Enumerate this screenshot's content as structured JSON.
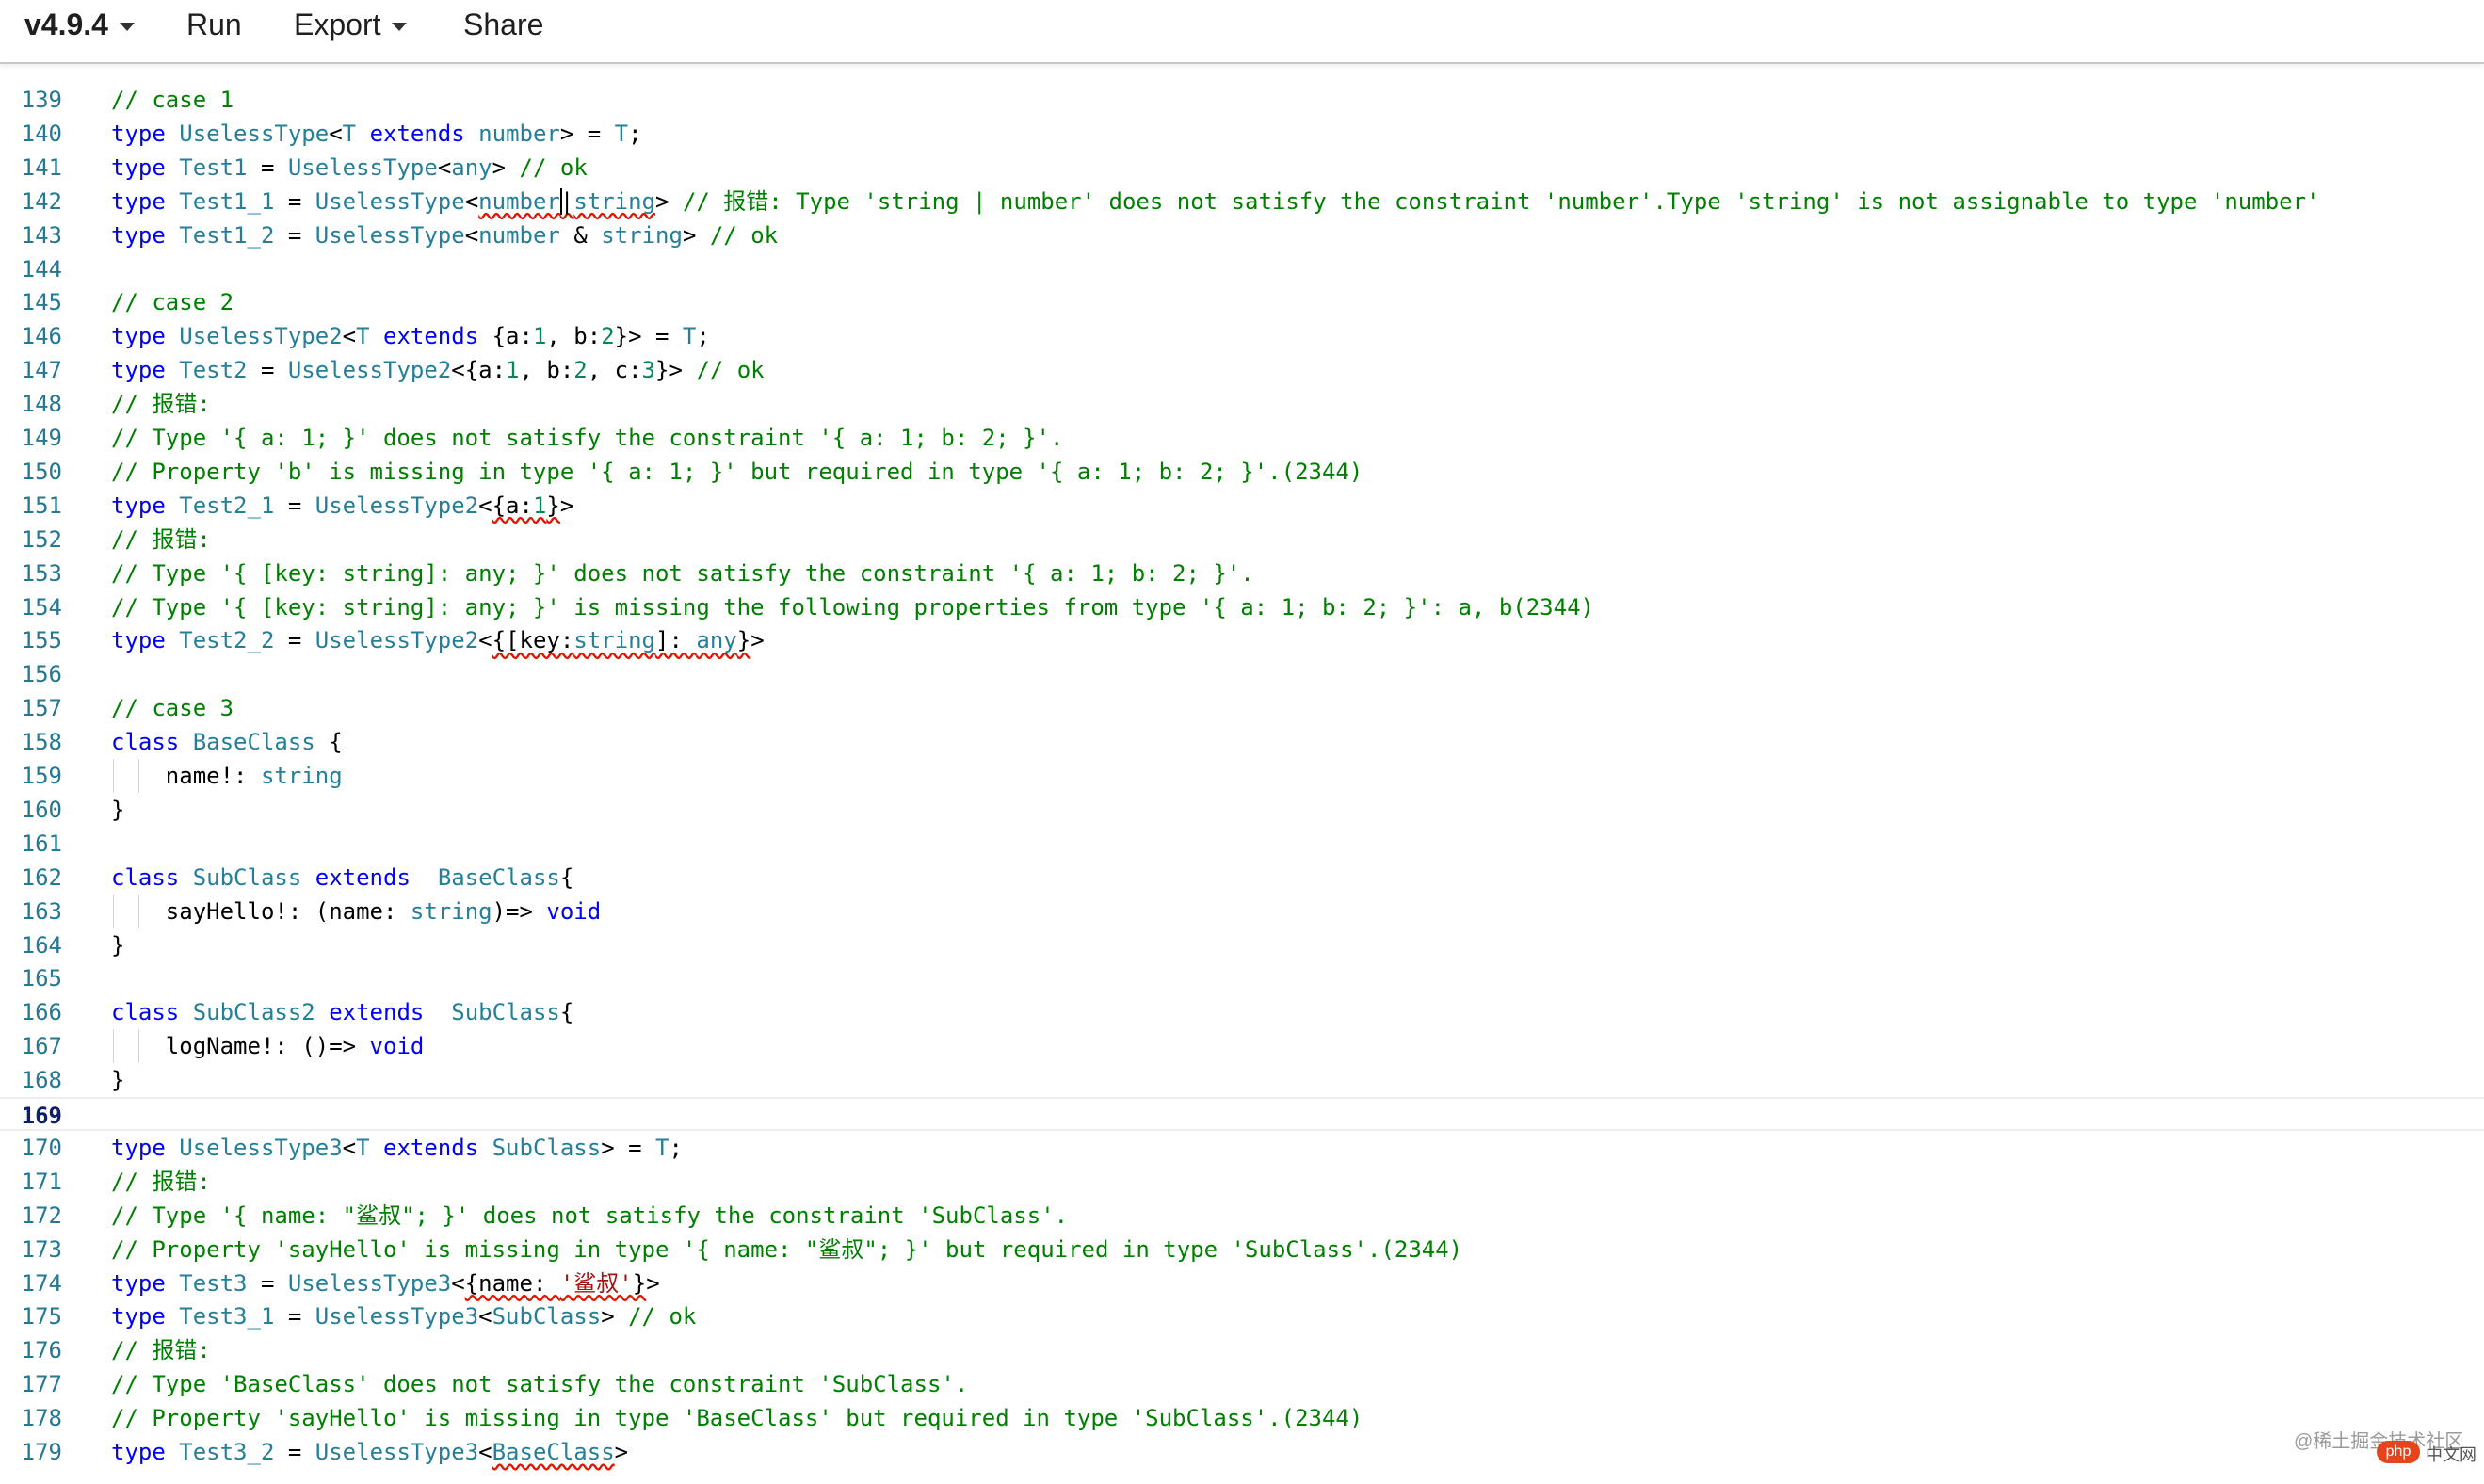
{
  "toolbar": {
    "version": "v4.9.4",
    "run": "Run",
    "export": "Export",
    "share": "Share"
  },
  "colors": {
    "keyword": "#0000ff",
    "type": "#267f99",
    "comment": "#008000",
    "string": "#a31515",
    "number": "#098658",
    "line_number": "#237893",
    "error_squiggle": "#e51400"
  },
  "editor": {
    "active_line": 169,
    "cursor": {
      "line": 142,
      "after_text": "type Test1_1 = UselessType<number"
    },
    "lines": [
      {
        "n": 139,
        "tokens": [
          [
            "comment",
            "// case 1"
          ]
        ]
      },
      {
        "n": 140,
        "tokens": [
          [
            "keyword",
            "type"
          ],
          [
            "plain",
            " "
          ],
          [
            "type",
            "UselessType"
          ],
          [
            "plain",
            "<"
          ],
          [
            "type",
            "T"
          ],
          [
            "plain",
            " "
          ],
          [
            "keyword",
            "extends"
          ],
          [
            "plain",
            " "
          ],
          [
            "type",
            "number"
          ],
          [
            "plain",
            "> = "
          ],
          [
            "type",
            "T"
          ],
          [
            "plain",
            ";"
          ]
        ]
      },
      {
        "n": 141,
        "tokens": [
          [
            "keyword",
            "type"
          ],
          [
            "plain",
            " "
          ],
          [
            "type",
            "Test1"
          ],
          [
            "plain",
            " = "
          ],
          [
            "type",
            "UselessType"
          ],
          [
            "plain",
            "<"
          ],
          [
            "type",
            "any"
          ],
          [
            "plain",
            "> "
          ],
          [
            "comment",
            "// ok"
          ]
        ]
      },
      {
        "n": 142,
        "tokens": [
          [
            "keyword",
            "type"
          ],
          [
            "plain",
            " "
          ],
          [
            "type",
            "Test1_1"
          ],
          [
            "plain",
            " = "
          ],
          [
            "type",
            "UselessType"
          ],
          [
            "plain",
            "<"
          ],
          [
            "type",
            "number",
            "err"
          ],
          [
            "plain",
            "|",
            "err"
          ],
          [
            "type",
            "string",
            "err"
          ],
          [
            "plain",
            "> "
          ],
          [
            "comment",
            "// 报错: Type 'string | number' does not satisfy the constraint 'number'.Type 'string' is not assignable to type 'number'"
          ]
        ]
      },
      {
        "n": 143,
        "tokens": [
          [
            "keyword",
            "type"
          ],
          [
            "plain",
            " "
          ],
          [
            "type",
            "Test1_2"
          ],
          [
            "plain",
            " = "
          ],
          [
            "type",
            "UselessType"
          ],
          [
            "plain",
            "<"
          ],
          [
            "type",
            "number"
          ],
          [
            "plain",
            " & "
          ],
          [
            "type",
            "string"
          ],
          [
            "plain",
            "> "
          ],
          [
            "comment",
            "// ok"
          ]
        ]
      },
      {
        "n": 144,
        "tokens": []
      },
      {
        "n": 145,
        "tokens": [
          [
            "comment",
            "// case 2"
          ]
        ]
      },
      {
        "n": 146,
        "tokens": [
          [
            "keyword",
            "type"
          ],
          [
            "plain",
            " "
          ],
          [
            "type",
            "UselessType2"
          ],
          [
            "plain",
            "<"
          ],
          [
            "type",
            "T"
          ],
          [
            "plain",
            " "
          ],
          [
            "keyword",
            "extends"
          ],
          [
            "plain",
            " {a:"
          ],
          [
            "number",
            "1"
          ],
          [
            "plain",
            ", b:"
          ],
          [
            "number",
            "2"
          ],
          [
            "plain",
            "}> = "
          ],
          [
            "type",
            "T"
          ],
          [
            "plain",
            ";"
          ]
        ]
      },
      {
        "n": 147,
        "tokens": [
          [
            "keyword",
            "type"
          ],
          [
            "plain",
            " "
          ],
          [
            "type",
            "Test2"
          ],
          [
            "plain",
            " = "
          ],
          [
            "type",
            "UselessType2"
          ],
          [
            "plain",
            "<{a:"
          ],
          [
            "number",
            "1"
          ],
          [
            "plain",
            ", b:"
          ],
          [
            "number",
            "2"
          ],
          [
            "plain",
            ", c:"
          ],
          [
            "number",
            "3"
          ],
          [
            "plain",
            "}> "
          ],
          [
            "comment",
            "// ok"
          ]
        ]
      },
      {
        "n": 148,
        "tokens": [
          [
            "comment",
            "// 报错:"
          ]
        ]
      },
      {
        "n": 149,
        "tokens": [
          [
            "comment",
            "// Type '{ a: 1; }' does not satisfy the constraint '{ a: 1; b: 2; }'."
          ]
        ]
      },
      {
        "n": 150,
        "tokens": [
          [
            "comment",
            "// Property 'b' is missing in type '{ a: 1; }' but required in type '{ a: 1; b: 2; }'.(2344)"
          ]
        ]
      },
      {
        "n": 151,
        "tokens": [
          [
            "keyword",
            "type"
          ],
          [
            "plain",
            " "
          ],
          [
            "type",
            "Test2_1"
          ],
          [
            "plain",
            " = "
          ],
          [
            "type",
            "UselessType2"
          ],
          [
            "plain",
            "<"
          ],
          [
            "plain",
            "{a:",
            "err"
          ],
          [
            "number",
            "1",
            "err"
          ],
          [
            "plain",
            "}",
            "err"
          ],
          [
            "plain",
            ">"
          ]
        ]
      },
      {
        "n": 152,
        "tokens": [
          [
            "comment",
            "// 报错:"
          ]
        ]
      },
      {
        "n": 153,
        "tokens": [
          [
            "comment",
            "// Type '{ [key: string]: any; }' does not satisfy the constraint '{ a: 1; b: 2; }'."
          ]
        ]
      },
      {
        "n": 154,
        "tokens": [
          [
            "comment",
            "// Type '{ [key: string]: any; }' is missing the following properties from type '{ a: 1; b: 2; }': a, b(2344)"
          ]
        ]
      },
      {
        "n": 155,
        "tokens": [
          [
            "keyword",
            "type"
          ],
          [
            "plain",
            " "
          ],
          [
            "type",
            "Test2_2"
          ],
          [
            "plain",
            " = "
          ],
          [
            "type",
            "UselessType2"
          ],
          [
            "plain",
            "<"
          ],
          [
            "plain",
            "{[key:",
            "err"
          ],
          [
            "type",
            "string",
            "err"
          ],
          [
            "plain",
            "]: ",
            "err"
          ],
          [
            "type",
            "any",
            "err"
          ],
          [
            "plain",
            "}",
            "err"
          ],
          [
            "plain",
            ">"
          ]
        ]
      },
      {
        "n": 156,
        "tokens": []
      },
      {
        "n": 157,
        "tokens": [
          [
            "comment",
            "// case 3"
          ]
        ]
      },
      {
        "n": 158,
        "tokens": [
          [
            "keyword",
            "class"
          ],
          [
            "plain",
            " "
          ],
          [
            "type",
            "BaseClass"
          ],
          [
            "plain",
            " {"
          ]
        ]
      },
      {
        "n": 159,
        "indent": 1,
        "tokens": [
          [
            "plain",
            "    name!: "
          ],
          [
            "type",
            "string"
          ]
        ]
      },
      {
        "n": 160,
        "tokens": [
          [
            "plain",
            "}"
          ]
        ]
      },
      {
        "n": 161,
        "tokens": []
      },
      {
        "n": 162,
        "tokens": [
          [
            "keyword",
            "class"
          ],
          [
            "plain",
            " "
          ],
          [
            "type",
            "SubClass"
          ],
          [
            "plain",
            " "
          ],
          [
            "keyword",
            "extends"
          ],
          [
            "plain",
            "  "
          ],
          [
            "type",
            "BaseClass"
          ],
          [
            "plain",
            "{"
          ]
        ]
      },
      {
        "n": 163,
        "indent": 1,
        "tokens": [
          [
            "plain",
            "    sayHello!: (name: "
          ],
          [
            "type",
            "string"
          ],
          [
            "plain",
            ")=> "
          ],
          [
            "keyword",
            "void"
          ]
        ]
      },
      {
        "n": 164,
        "tokens": [
          [
            "plain",
            "}"
          ]
        ]
      },
      {
        "n": 165,
        "tokens": []
      },
      {
        "n": 166,
        "tokens": [
          [
            "keyword",
            "class"
          ],
          [
            "plain",
            " "
          ],
          [
            "type",
            "SubClass2"
          ],
          [
            "plain",
            " "
          ],
          [
            "keyword",
            "extends"
          ],
          [
            "plain",
            "  "
          ],
          [
            "type",
            "SubClass"
          ],
          [
            "plain",
            "{"
          ]
        ]
      },
      {
        "n": 167,
        "indent": 1,
        "tokens": [
          [
            "plain",
            "    logName!: ()=> "
          ],
          [
            "keyword",
            "void"
          ]
        ]
      },
      {
        "n": 168,
        "tokens": [
          [
            "plain",
            "}"
          ]
        ]
      },
      {
        "n": 169,
        "tokens": []
      },
      {
        "n": 170,
        "tokens": [
          [
            "keyword",
            "type"
          ],
          [
            "plain",
            " "
          ],
          [
            "type",
            "UselessType3"
          ],
          [
            "plain",
            "<"
          ],
          [
            "type",
            "T"
          ],
          [
            "plain",
            " "
          ],
          [
            "keyword",
            "extends"
          ],
          [
            "plain",
            " "
          ],
          [
            "type",
            "SubClass"
          ],
          [
            "plain",
            "> = "
          ],
          [
            "type",
            "T"
          ],
          [
            "plain",
            ";"
          ]
        ]
      },
      {
        "n": 171,
        "tokens": [
          [
            "comment",
            "// 报错:"
          ]
        ]
      },
      {
        "n": 172,
        "tokens": [
          [
            "comment",
            "// Type '{ name: \"鲨叔\"; }' does not satisfy the constraint 'SubClass'."
          ]
        ]
      },
      {
        "n": 173,
        "tokens": [
          [
            "comment",
            "// Property 'sayHello' is missing in type '{ name: \"鲨叔\"; }' but required in type 'SubClass'.(2344)"
          ]
        ]
      },
      {
        "n": 174,
        "tokens": [
          [
            "keyword",
            "type"
          ],
          [
            "plain",
            " "
          ],
          [
            "type",
            "Test3"
          ],
          [
            "plain",
            " = "
          ],
          [
            "type",
            "UselessType3"
          ],
          [
            "plain",
            "<"
          ],
          [
            "plain",
            "{name: ",
            "err"
          ],
          [
            "string",
            "'鲨叔'",
            "err"
          ],
          [
            "plain",
            "}",
            "err"
          ],
          [
            "plain",
            ">"
          ]
        ]
      },
      {
        "n": 175,
        "tokens": [
          [
            "keyword",
            "type"
          ],
          [
            "plain",
            " "
          ],
          [
            "type",
            "Test3_1"
          ],
          [
            "plain",
            " = "
          ],
          [
            "type",
            "UselessType3"
          ],
          [
            "plain",
            "<"
          ],
          [
            "type",
            "SubClass"
          ],
          [
            "plain",
            "> "
          ],
          [
            "comment",
            "// ok"
          ]
        ]
      },
      {
        "n": 176,
        "tokens": [
          [
            "comment",
            "// 报错:"
          ]
        ]
      },
      {
        "n": 177,
        "tokens": [
          [
            "comment",
            "// Type 'BaseClass' does not satisfy the constraint 'SubClass'."
          ]
        ]
      },
      {
        "n": 178,
        "tokens": [
          [
            "comment",
            "// Property 'sayHello' is missing in type 'BaseClass' but required in type 'SubClass'.(2344)"
          ]
        ]
      },
      {
        "n": 179,
        "tokens": [
          [
            "keyword",
            "type"
          ],
          [
            "plain",
            " "
          ],
          [
            "type",
            "Test3_2"
          ],
          [
            "plain",
            " = "
          ],
          [
            "type",
            "UselessType3"
          ],
          [
            "plain",
            "<"
          ],
          [
            "type",
            "BaseClass",
            "err"
          ],
          [
            "plain",
            ">"
          ]
        ]
      }
    ]
  },
  "watermark": {
    "text": "@稀土掘金技术社区",
    "logo": "php",
    "site": "中文网"
  }
}
